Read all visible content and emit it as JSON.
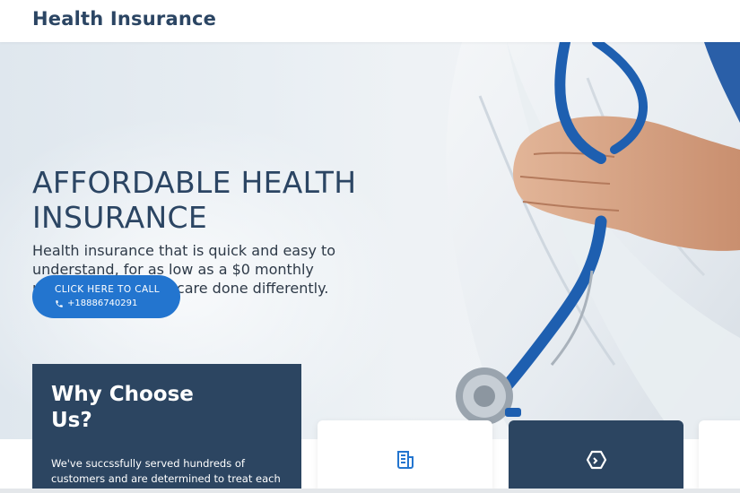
{
  "header": {
    "brand": "Health Insurance"
  },
  "hero": {
    "title": "AFFORDABLE HEALTH INSURANCE",
    "description": "Health insurance that is quick and easy to understand, for as low as a $0 monthly payment. It's healthcare done differently.",
    "cta": {
      "label": "CLICK HERE TO CALL",
      "phone": "+18886740291",
      "icon": "phone-icon"
    },
    "image": "doctor-with-stethoscope"
  },
  "why": {
    "title": "Why Choose Us?",
    "text": "We've succssfully served hundreds of customers and are determined to treat each"
  },
  "cards": [
    {
      "icon": "document-icon"
    },
    {
      "icon": "hexagon-icon"
    },
    {
      "icon": ""
    }
  ],
  "colors": {
    "primary": "#2b4563",
    "accent": "#2375cf",
    "card_dark": "#2c4561"
  }
}
